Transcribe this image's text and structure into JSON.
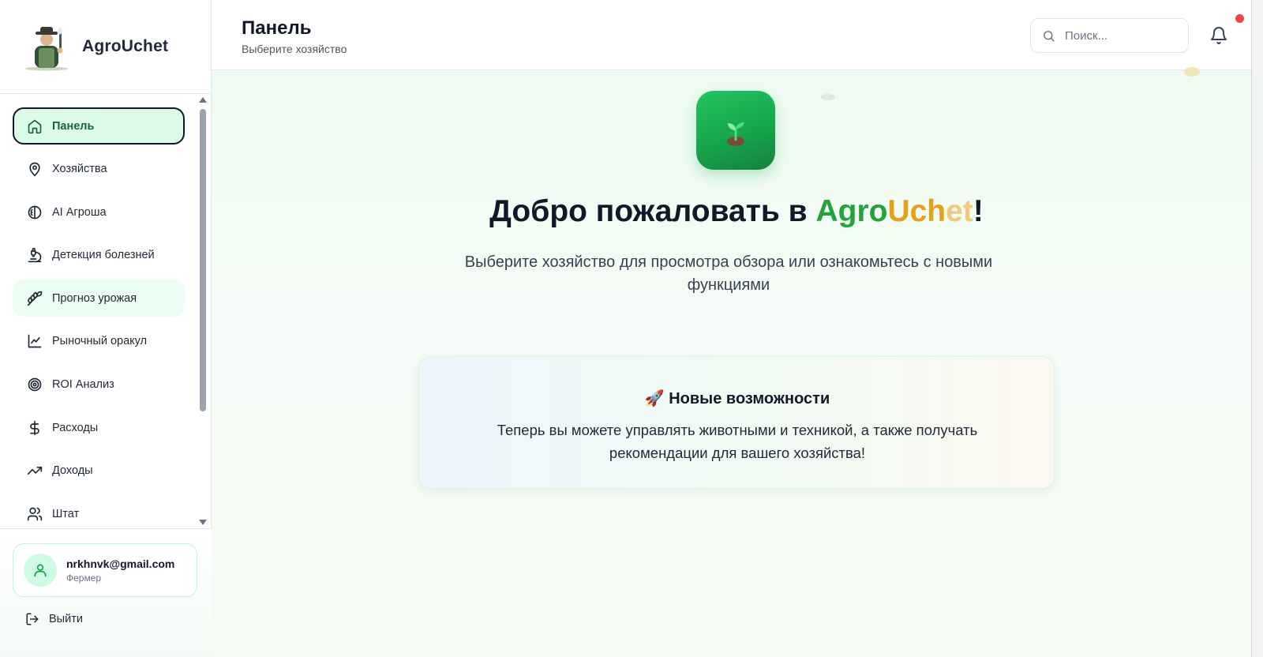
{
  "app": {
    "name": "AgroUchet"
  },
  "sidebar": {
    "items": [
      {
        "label": "Панель",
        "icon": "home-icon"
      },
      {
        "label": "Хозяйства",
        "icon": "map-pin-icon"
      },
      {
        "label": "AI Агроша",
        "icon": "brain-icon"
      },
      {
        "label": "Детекция болезней",
        "icon": "microscope-icon"
      },
      {
        "label": "Прогноз урожая",
        "icon": "wheat-icon"
      },
      {
        "label": "Рыночный оракул",
        "icon": "line-chart-icon"
      },
      {
        "label": "ROI Анализ",
        "icon": "target-icon"
      },
      {
        "label": "Расходы",
        "icon": "dollar-icon"
      },
      {
        "label": "Доходы",
        "icon": "trending-up-icon"
      },
      {
        "label": "Штат",
        "icon": "users-icon"
      }
    ]
  },
  "user": {
    "email": "nrkhnvk@gmail.com",
    "role": "Фермер"
  },
  "logout_label": "Выйти",
  "header": {
    "title": "Панель",
    "subtitle": "Выберите хозяйство",
    "search_placeholder": "Поиск..."
  },
  "main": {
    "welcome_prefix": "Добро пожаловать в ",
    "brand_part1": "Agro",
    "brand_part2": "Uch",
    "brand_part3": "et",
    "welcome_suffix": "!",
    "welcome_sub": "Выберите хозяйство для просмотра обзора или ознакомьтесь с новыми функциями",
    "feature_emoji": "🚀",
    "feature_title": "Новые возможности",
    "feature_text": "Теперь вы можете управлять животными и техникой, а также получать рекомендации для вашего хозяйства!"
  },
  "colors": {
    "accent": "#16a34a",
    "active_bg": "#dcfce7",
    "notification": "#ef4444"
  }
}
